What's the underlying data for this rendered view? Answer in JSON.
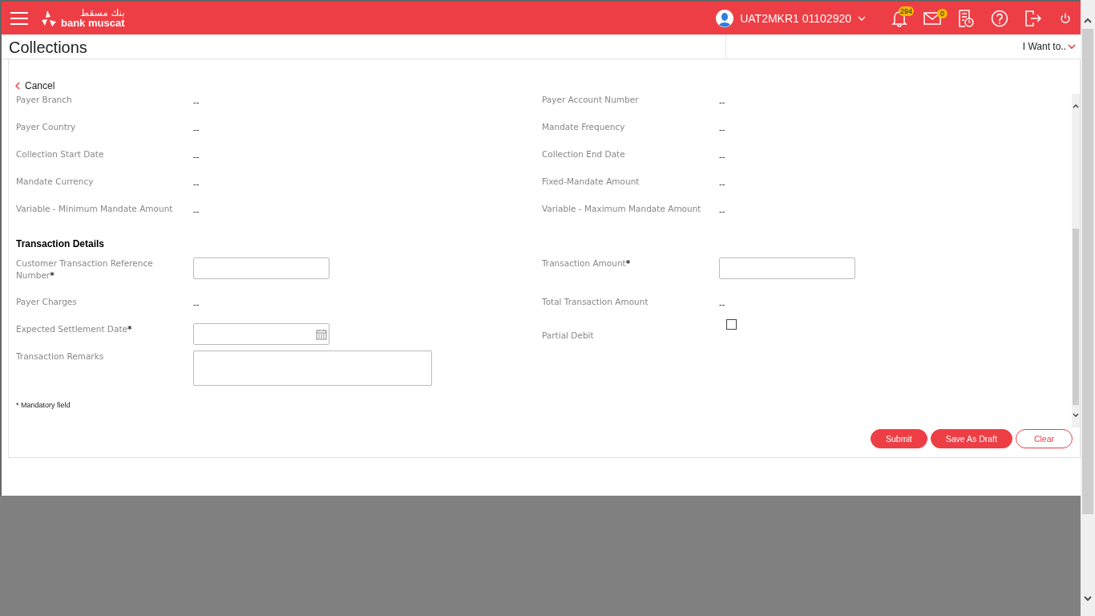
{
  "header": {
    "logo": {
      "arabic": "بنك مسقط",
      "latin": "bank muscat"
    },
    "user": "UAT2MKR1 01102920",
    "notifications_badge": "294",
    "messages_badge": "0"
  },
  "page": {
    "title": "Collections",
    "menu": "I Want to..",
    "back": "Cancel"
  },
  "mandate_fields": [
    {
      "label": "Payer Branch",
      "value": "--"
    },
    {
      "label": "Payer Account Number",
      "value": "--"
    },
    {
      "label": "Payer Country",
      "value": "--"
    },
    {
      "label": "Mandate Frequency",
      "value": "--"
    },
    {
      "label": "Collection Start Date",
      "value": "--"
    },
    {
      "label": "Collection End Date",
      "value": "--"
    },
    {
      "label": "Mandate Currency",
      "value": "--"
    },
    {
      "label": "Fixed-Mandate Amount",
      "value": "--"
    },
    {
      "label": "Variable - Minimum Mandate Amount",
      "value": "--"
    },
    {
      "label": "Variable - Maximum Mandate Amount",
      "value": "--"
    }
  ],
  "transaction": {
    "title": "Transaction Details",
    "fields": [
      {
        "kind": "input",
        "label": "Customer Transaction Reference Number",
        "required_mark": "*"
      },
      {
        "kind": "input",
        "label": "Transaction Amount",
        "required_mark": "*"
      },
      {
        "kind": "value",
        "label": "Payer Charges",
        "value": "--"
      },
      {
        "kind": "value",
        "label": "Total Transaction Amount",
        "value": "--"
      },
      {
        "kind": "date",
        "label": "Expected Settlement Date",
        "required_mark": "*"
      },
      {
        "kind": "checkbox",
        "label": "Partial Debit",
        "checked": false
      },
      {
        "kind": "textarea",
        "label": "Transaction Remarks"
      }
    ]
  },
  "footnote": "*  Mandatory field",
  "buttons": [
    {
      "label": "Submit",
      "kind": "primary"
    },
    {
      "label": "Save As Draft",
      "kind": "primary"
    },
    {
      "label": "Clear",
      "kind": "outline"
    }
  ]
}
